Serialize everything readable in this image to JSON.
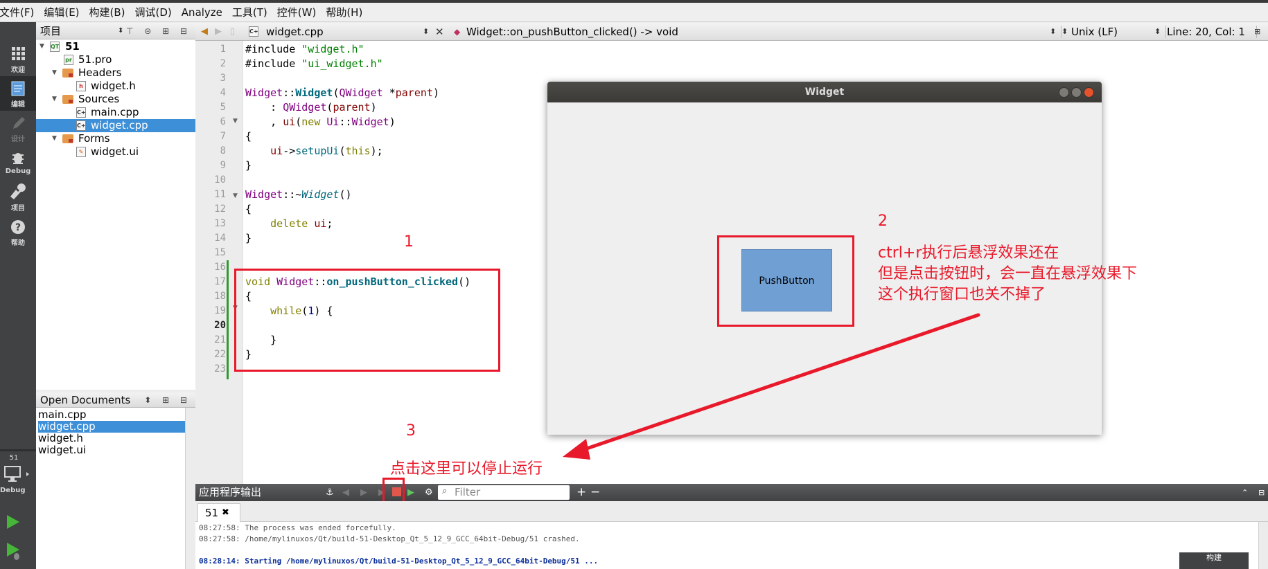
{
  "menubar": [
    "文件(F)",
    "编辑(E)",
    "构建(B)",
    "调试(D)",
    "Analyze",
    "工具(T)",
    "控件(W)",
    "帮助(H)"
  ],
  "modes": [
    {
      "label": "欢迎",
      "icon": "grid-icon"
    },
    {
      "label": "编辑",
      "icon": "edit-icon"
    },
    {
      "label": "设计",
      "icon": "pencil-icon"
    },
    {
      "label": "Debug",
      "icon": "bug-icon"
    },
    {
      "label": "项目",
      "icon": "wrench-icon"
    },
    {
      "label": "帮助",
      "icon": "help-icon"
    }
  ],
  "kit": {
    "project": "51",
    "config": "Debug"
  },
  "project_panel": {
    "title": "项目",
    "tree": [
      {
        "label": "51",
        "level": 0,
        "type": "project"
      },
      {
        "label": "51.pro",
        "level": 1,
        "type": "pro"
      },
      {
        "label": "Headers",
        "level": 1,
        "type": "folder"
      },
      {
        "label": "widget.h",
        "level": 2,
        "type": "h"
      },
      {
        "label": "Sources",
        "level": 1,
        "type": "folder"
      },
      {
        "label": "main.cpp",
        "level": 2,
        "type": "cpp"
      },
      {
        "label": "widget.cpp",
        "level": 2,
        "type": "cpp",
        "selected": true
      },
      {
        "label": "Forms",
        "level": 1,
        "type": "folder"
      },
      {
        "label": "widget.ui",
        "level": 2,
        "type": "ui"
      }
    ]
  },
  "open_docs": {
    "title": "Open Documents",
    "items": [
      "main.cpp",
      "widget.cpp",
      "widget.h",
      "widget.ui"
    ],
    "selected": "widget.cpp"
  },
  "editor": {
    "file": "widget.cpp",
    "symbol": "Widget::on_pushButton_clicked() -> void",
    "line_ending": "Unix (LF)",
    "cursor": "Line: 20, Col: 1",
    "line_count": 23,
    "current_line": 20
  },
  "widget_window": {
    "title": "Widget",
    "button": "PushButton"
  },
  "annotations": {
    "n1": "1",
    "n2": "2",
    "n3": "3",
    "desc_line1": "ctrl+r执行后悬浮效果还在",
    "desc_line2": "但是点击按钮时，会一直在悬浮效果下",
    "desc_line3": "这个执行窗口也关不掉了",
    "stop_hint": "点击这里可以停止运行"
  },
  "output": {
    "title": "应用程序输出",
    "filter_placeholder": "Filter",
    "tab": "51",
    "lines": [
      {
        "text": "08:27:58: The process was ended forcefully.",
        "bold": false,
        "color": "#555555"
      },
      {
        "text": "08:27:58: /home/mylinuxos/Qt/build-51-Desktop_Qt_5_12_9_GCC_64bit-Debug/51 crashed.",
        "bold": false,
        "color": "#555555"
      },
      {
        "text": "08:28:14: Starting /home/mylinuxos/Qt/build-51-Desktop_Qt_5_12_9_GCC_64bit-Debug/51 ...",
        "bold": true,
        "color": "#0b2f9a"
      }
    ]
  },
  "build_badge": "构建"
}
